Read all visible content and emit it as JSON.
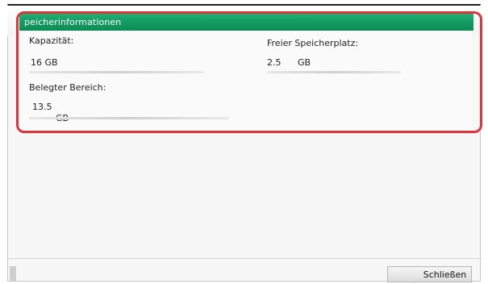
{
  "dialog": {
    "title": "peicherinformationen"
  },
  "capacity": {
    "label": "Kapazität:",
    "value": "16 GB"
  },
  "free_space": {
    "label": "Freier Speicherplatz:",
    "value_number": "2.5",
    "value_unit": "GB"
  },
  "used_area": {
    "label": "Belegter Bereich:",
    "value_number": "13.5",
    "value_unit": "GB"
  },
  "buttons": {
    "close_label": "Schließen"
  },
  "colors": {
    "title_bar": "#129a5f",
    "highlight": "#e0343d"
  }
}
